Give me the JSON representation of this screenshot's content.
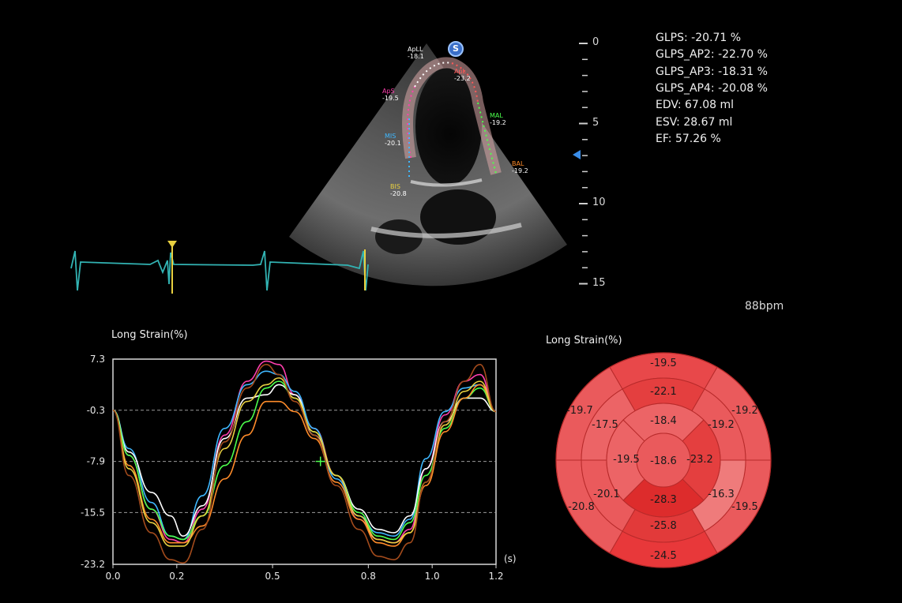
{
  "measurements": [
    {
      "label": "GLPS:",
      "value": "-20.71 %"
    },
    {
      "label": "GLPS_AP2:",
      "value": "-22.70 %"
    },
    {
      "label": "GLPS_AP3:",
      "value": "-18.31 %"
    },
    {
      "label": "GLPS_AP4:",
      "value": "-20.08 %"
    },
    {
      "label": "EDV:",
      "value": "67.08 ml"
    },
    {
      "label": "ESV:",
      "value": "28.67 ml"
    },
    {
      "label": "EF:",
      "value": "57.26 %"
    }
  ],
  "heart_rate": "88bpm",
  "depth_scale": [
    "0",
    "5",
    "10",
    "15"
  ],
  "image_segments": [
    {
      "name": "ApLL",
      "value": "-18.1",
      "color": "#ffffff"
    },
    {
      "name": "ApL",
      "value": "-23.2",
      "color": "#ff5a5a"
    },
    {
      "name": "ApS",
      "value": "-19.5",
      "color": "#ff3fae"
    },
    {
      "name": "MAL",
      "value": "-19.2",
      "color": "#4cff4c"
    },
    {
      "name": "MIS",
      "value": "-20.1",
      "color": "#3fb8ff"
    },
    {
      "name": "BAL",
      "value": "-19.2",
      "color": "#ff8c2a"
    },
    {
      "name": "BIS",
      "value": "-20.8",
      "color": "#e8d040"
    }
  ],
  "badge": "S",
  "strain_panel": {
    "title": "Long Strain(%)"
  },
  "bullseye_panel": {
    "title": "Long Strain(%)",
    "outer": [
      "-19.5",
      "-19.2",
      "-19.5",
      "-24.5",
      "-20.8",
      "-19.7"
    ],
    "middle": [
      "-22.1",
      "-19.2",
      "-16.3",
      "-25.8",
      "-20.1",
      "-17.5"
    ],
    "inner": [
      "-18.4",
      "-23.2",
      "-28.3",
      "-19.5"
    ],
    "apex": "-18.6",
    "outer_colors": [
      "#e8484a",
      "#ea5a5c",
      "#ea5a5c",
      "#e8383a",
      "#ea5a5c",
      "#ea5a5c"
    ],
    "middle_colors": [
      "#e43f3f",
      "#ea5a5c",
      "#ef7b7b",
      "#e23a3a",
      "#ea5a5c",
      "#ec6466"
    ],
    "inner_colors": [
      "#ec6466",
      "#e43f3f",
      "#dd2c2c",
      "#ec6466"
    ],
    "apex_color": "#ea5a5c"
  },
  "chart_data": {
    "type": "line",
    "title": "Long Strain(%)",
    "xlabel": "(s)",
    "ylabel": "",
    "xlim": [
      0.0,
      1.2
    ],
    "ylim": [
      -23.2,
      7.3
    ],
    "xticks": [
      "0.0",
      "0.2",
      "0.5",
      "0.8",
      "1.0",
      "1.2"
    ],
    "yticks": [
      "7.3",
      "-0.3",
      "-7.9",
      "-15.5",
      "-23.2"
    ],
    "series": [
      {
        "color": "#ff3fae",
        "x": [
          0.0,
          0.05,
          0.12,
          0.18,
          0.22,
          0.28,
          0.35,
          0.42,
          0.48,
          0.52,
          0.57,
          0.63,
          0.7,
          0.77,
          0.83,
          0.88,
          0.93,
          0.98,
          1.04,
          1.1,
          1.15,
          1.2
        ],
        "y": [
          -0.3,
          -7.0,
          -15.0,
          -19.5,
          -20.0,
          -15.0,
          -4.0,
          4.0,
          7.0,
          6.5,
          2.0,
          -3.0,
          -10.0,
          -16.5,
          -19.5,
          -20.0,
          -18.0,
          -9.0,
          -1.0,
          4.0,
          5.0,
          -0.5
        ]
      },
      {
        "color": "#3fb8ff",
        "x": [
          0.0,
          0.05,
          0.12,
          0.18,
          0.22,
          0.28,
          0.35,
          0.42,
          0.48,
          0.52,
          0.57,
          0.63,
          0.7,
          0.77,
          0.83,
          0.88,
          0.93,
          0.98,
          1.04,
          1.1,
          1.15,
          1.2
        ],
        "y": [
          -0.3,
          -6.0,
          -14.0,
          -19.0,
          -19.5,
          -13.0,
          -3.0,
          3.5,
          5.5,
          5.0,
          2.5,
          -3.0,
          -10.5,
          -16.0,
          -18.5,
          -19.0,
          -16.5,
          -7.5,
          -0.5,
          3.0,
          3.5,
          -0.5
        ]
      },
      {
        "color": "#ffffff",
        "x": [
          0.0,
          0.05,
          0.12,
          0.18,
          0.22,
          0.28,
          0.35,
          0.42,
          0.48,
          0.52,
          0.57,
          0.63,
          0.7,
          0.77,
          0.83,
          0.88,
          0.93,
          0.98,
          1.04,
          1.1,
          1.15,
          1.2
        ],
        "y": [
          -0.3,
          -6.5,
          -12.5,
          -16.0,
          -19.0,
          -14.5,
          -4.5,
          1.5,
          2.0,
          3.5,
          2.0,
          -4.0,
          -10.0,
          -15.0,
          -18.0,
          -18.5,
          -16.0,
          -9.0,
          -2.0,
          1.5,
          1.5,
          -0.5
        ]
      },
      {
        "color": "#4cff4c",
        "x": [
          0.0,
          0.05,
          0.12,
          0.18,
          0.22,
          0.28,
          0.35,
          0.42,
          0.48,
          0.52,
          0.57,
          0.63,
          0.7,
          0.77,
          0.83,
          0.88,
          0.93,
          0.98,
          1.04,
          1.1,
          1.15,
          1.2
        ],
        "y": [
          -0.3,
          -7.0,
          -15.0,
          -19.0,
          -19.5,
          -16.0,
          -8.5,
          -2.0,
          3.0,
          4.0,
          1.5,
          -3.5,
          -10.0,
          -15.5,
          -19.0,
          -19.5,
          -17.0,
          -10.0,
          -3.0,
          1.5,
          3.0,
          -0.5
        ]
      },
      {
        "color": "#ff8c2a",
        "x": [
          0.0,
          0.05,
          0.12,
          0.18,
          0.22,
          0.28,
          0.35,
          0.42,
          0.48,
          0.52,
          0.57,
          0.63,
          0.7,
          0.77,
          0.83,
          0.88,
          0.93,
          0.98,
          1.04,
          1.1,
          1.15,
          1.2
        ],
        "y": [
          -0.3,
          -8.5,
          -16.5,
          -20.0,
          -20.0,
          -17.5,
          -10.5,
          -4.0,
          1.0,
          1.0,
          -0.5,
          -4.5,
          -11.0,
          -16.5,
          -20.0,
          -20.5,
          -18.5,
          -11.5,
          -3.5,
          1.5,
          3.5,
          -0.5
        ]
      },
      {
        "color": "#e8d040",
        "x": [
          0.0,
          0.05,
          0.12,
          0.18,
          0.22,
          0.28,
          0.35,
          0.42,
          0.48,
          0.52,
          0.57,
          0.63,
          0.7,
          0.77,
          0.83,
          0.88,
          0.93,
          0.98,
          1.04,
          1.1,
          1.15,
          1.2
        ],
        "y": [
          -0.3,
          -9.0,
          -17.0,
          -20.5,
          -20.5,
          -16.0,
          -6.0,
          1.0,
          3.5,
          4.5,
          1.5,
          -3.5,
          -10.0,
          -16.0,
          -19.5,
          -20.0,
          -18.5,
          -11.0,
          -2.5,
          2.5,
          4.0,
          -0.5
        ]
      },
      {
        "color": "#a34b1c",
        "x": [
          0.0,
          0.05,
          0.12,
          0.18,
          0.22,
          0.28,
          0.35,
          0.42,
          0.48,
          0.52,
          0.57,
          0.63,
          0.7,
          0.77,
          0.83,
          0.88,
          0.93,
          0.98,
          1.04,
          1.1,
          1.15,
          1.2
        ],
        "y": [
          -0.3,
          -10.0,
          -18.5,
          -22.5,
          -23.0,
          -18.0,
          -5.0,
          3.0,
          6.5,
          5.0,
          1.0,
          -4.0,
          -11.5,
          -18.0,
          -22.0,
          -22.5,
          -20.0,
          -11.0,
          -2.0,
          4.0,
          6.5,
          -0.5
        ]
      }
    ]
  }
}
